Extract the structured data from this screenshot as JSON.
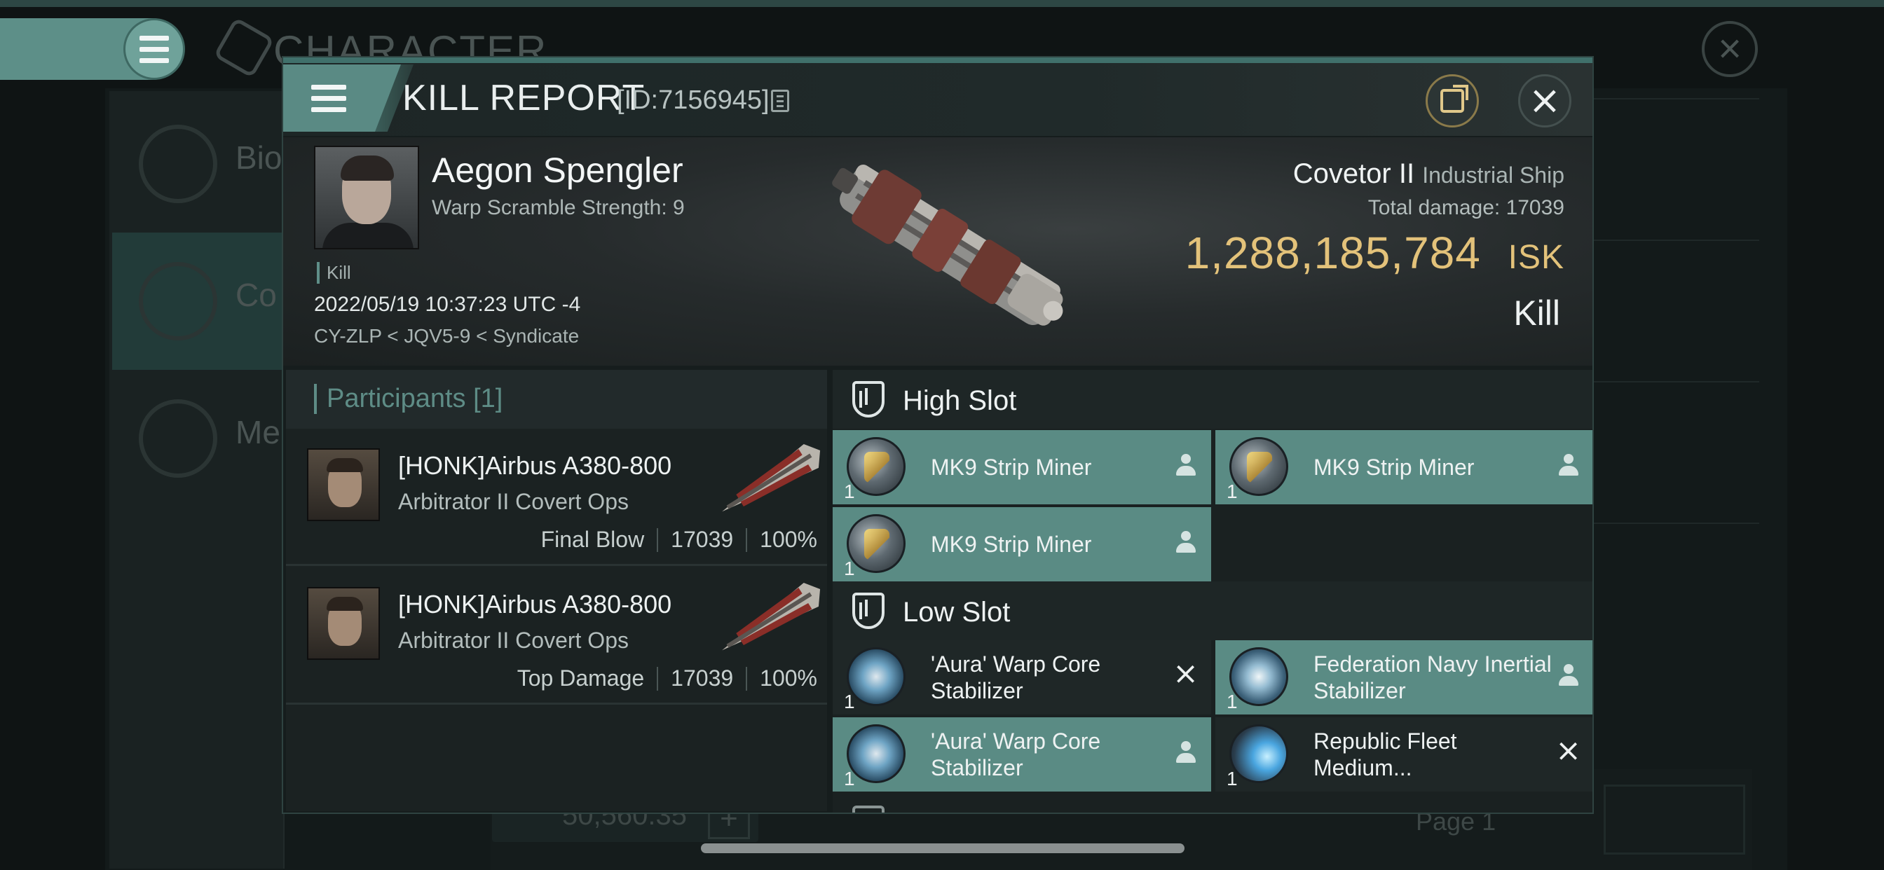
{
  "background": {
    "title": "CHARACTER",
    "side_items": [
      "Bio",
      "Co",
      "Me"
    ],
    "footer_isk": "50,560.35",
    "footer_page": "Page 1"
  },
  "modal": {
    "title": "KILL REPORT",
    "id_label": "[ID:7156945]",
    "victim": {
      "name": "Aegon Spengler",
      "warp_scramble": "Warp Scramble Strength: 9",
      "tag": "Kill",
      "datetime": "2022/05/19 10:37:23 UTC -4",
      "location": "CY-ZLP < JQV5-9 < Syndicate"
    },
    "ship": {
      "name": "Covetor II",
      "class": "Industrial Ship",
      "total_damage_label": "Total damage:",
      "total_damage": "17039",
      "isk_value": "1,288,185,784",
      "isk_unit": "ISK",
      "result": "Kill"
    },
    "participants": {
      "header": "Participants [1]",
      "rows": [
        {
          "name": "[HONK]Airbus A380-800",
          "ship": "Arbitrator II Covert Ops",
          "role": "Final Blow",
          "damage": "17039",
          "percent": "100%"
        },
        {
          "name": "[HONK]Airbus A380-800",
          "ship": "Arbitrator II Covert Ops",
          "role": "Top Damage",
          "damage": "17039",
          "percent": "100%"
        }
      ]
    },
    "slots": {
      "high": {
        "label": "High Slot",
        "modules": [
          {
            "qty": "1",
            "name": "MK9 Strip Miner",
            "status": "dropped"
          },
          {
            "qty": "1",
            "name": "MK9 Strip Miner",
            "status": "dropped"
          },
          {
            "qty": "1",
            "name": "MK9 Strip Miner",
            "status": "dropped"
          }
        ]
      },
      "low": {
        "label": "Low Slot",
        "modules": [
          {
            "qty": "1",
            "name": "'Aura' Warp Core Stabilizer",
            "status": "destroyed"
          },
          {
            "qty": "1",
            "name": "Federation Navy Inertial Stabilizer",
            "status": "dropped"
          },
          {
            "qty": "1",
            "name": "'Aura' Warp Core Stabilizer",
            "status": "dropped"
          },
          {
            "qty": "1",
            "name": "Republic Fleet Medium...",
            "status": "destroyed"
          }
        ]
      }
    }
  },
  "colors": {
    "accent": "#5a8b84",
    "isk_gold": "#e3c27a",
    "panel": "#161d1d"
  }
}
